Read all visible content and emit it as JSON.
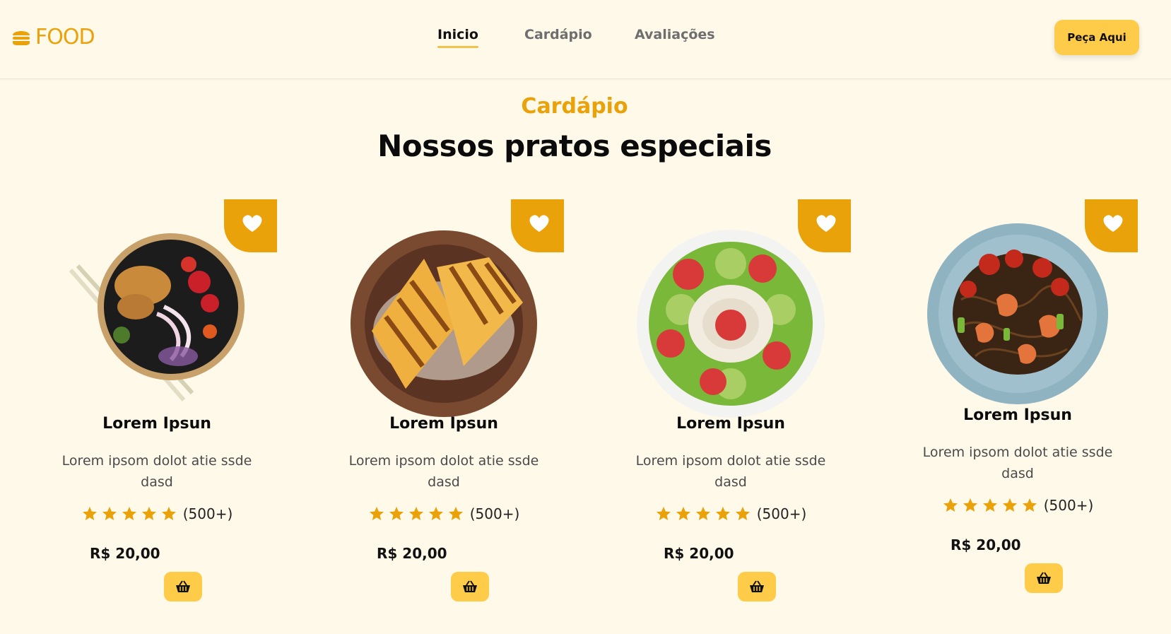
{
  "header": {
    "logo_text": "FOOD",
    "nav": [
      {
        "label": "Inicio",
        "active": true
      },
      {
        "label": "Cardápio",
        "active": false
      },
      {
        "label": "Avaliações",
        "active": false
      }
    ],
    "order_button": "Peça Aqui"
  },
  "section": {
    "kicker": "Cardápio",
    "title": "Nossos pratos especiais"
  },
  "dishes": [
    {
      "name": "Lorem Ipsun",
      "description": "Lorem ipsom dolot atie ssde dasd",
      "rating_count": "(500+)",
      "stars": 5,
      "price": "R$ 20,00",
      "image": "poke-bowl"
    },
    {
      "name": "Lorem Ipsun",
      "description": "Lorem ipsom dolot atie ssde dasd",
      "rating_count": "(500+)",
      "stars": 5,
      "price": "R$ 20,00",
      "image": "grilled-sandwich"
    },
    {
      "name": "Lorem Ipsun",
      "description": "Lorem ipsom dolot atie ssde dasd",
      "rating_count": "(500+)",
      "stars": 5,
      "price": "R$ 20,00",
      "image": "smoothie-bowl"
    },
    {
      "name": "Lorem Ipsun",
      "description": "Lorem ipsom dolot atie ssde dasd",
      "rating_count": "(500+)",
      "stars": 5,
      "price": "R$ 20,00",
      "image": "shrimp-noodles"
    }
  ],
  "icons": {
    "logo": "burger-icon",
    "favorite": "heart-icon",
    "star": "star-icon",
    "cart": "basket-icon"
  },
  "colors": {
    "accent": "#e9a20a",
    "button": "#ffcc4a",
    "background": "#fff9ea"
  }
}
